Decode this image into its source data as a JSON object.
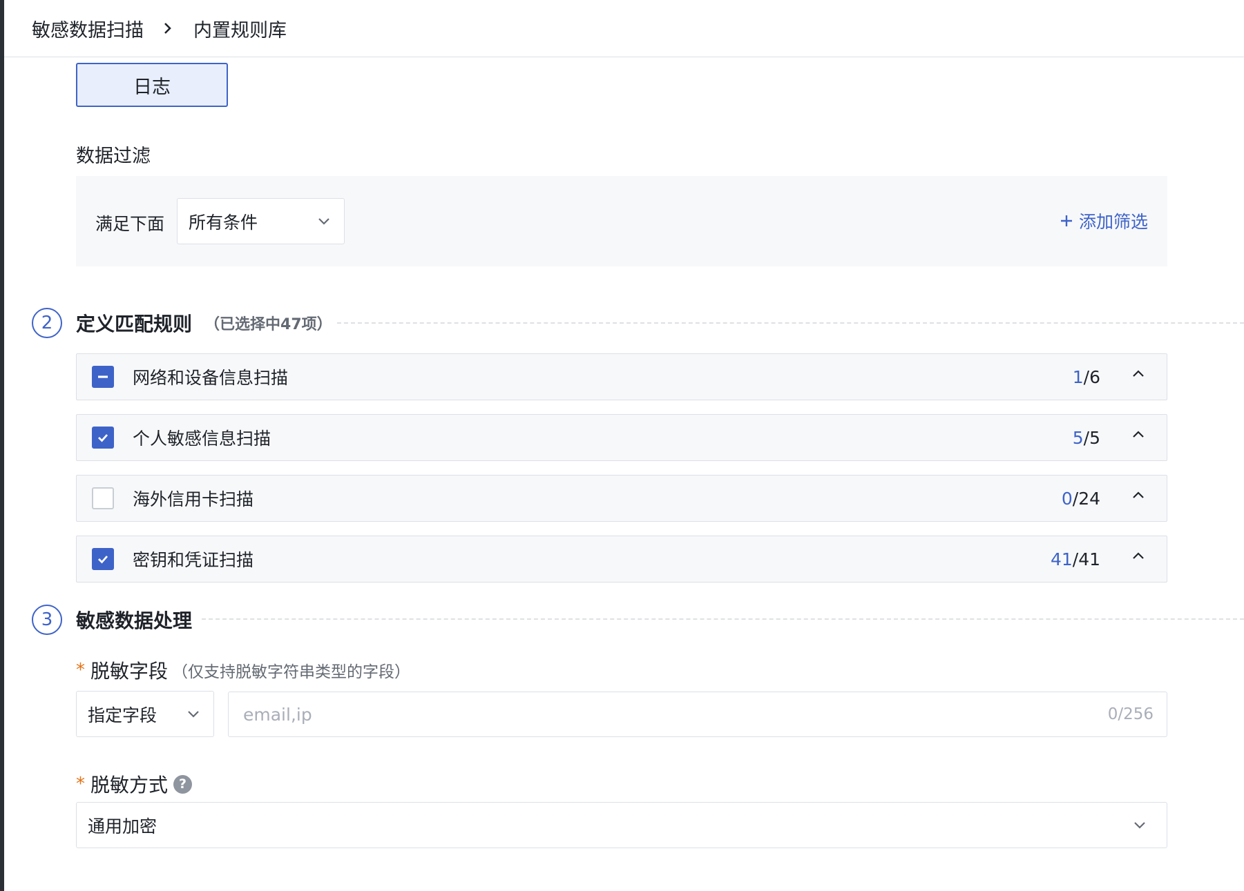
{
  "breadcrumb": {
    "parent": "敏感数据扫描",
    "current": "内置规则库"
  },
  "log_button": {
    "label": "日志"
  },
  "data_filter": {
    "title": "数据过滤",
    "match_label": "满足下面",
    "match_select": "所有条件",
    "add_filter": "添加筛选"
  },
  "step2": {
    "number": "2",
    "title": "定义匹配规则",
    "subtitle": "（已选择中47项）"
  },
  "rule_groups": [
    {
      "name": "网络和设备信息扫描",
      "selected": "1",
      "total": "/6",
      "state": "indeterminate"
    },
    {
      "name": "个人敏感信息扫描",
      "selected": "5",
      "total": "/5",
      "state": "checked"
    },
    {
      "name": "海外信用卡扫描",
      "selected": "0",
      "total": "/24",
      "state": "unchecked"
    },
    {
      "name": "密钥和凭证扫描",
      "selected": "41",
      "total": "/41",
      "state": "checked"
    }
  ],
  "step3": {
    "number": "3",
    "title": "敏感数据处理"
  },
  "mask_field": {
    "required_mark": "*",
    "label": "脱敏字段",
    "hint": "（仅支持脱敏字符串类型的字段）",
    "type_select": "指定字段",
    "input_placeholder": "email,ip",
    "input_value": "",
    "counter": "0/256"
  },
  "mask_method": {
    "required_mark": "*",
    "label": "脱敏方式",
    "help_glyph": "?",
    "select_value": "通用加密"
  },
  "colors": {
    "accent": "#3e63c8",
    "required": "#e37318",
    "panel_bg": "#f7f8fa"
  }
}
